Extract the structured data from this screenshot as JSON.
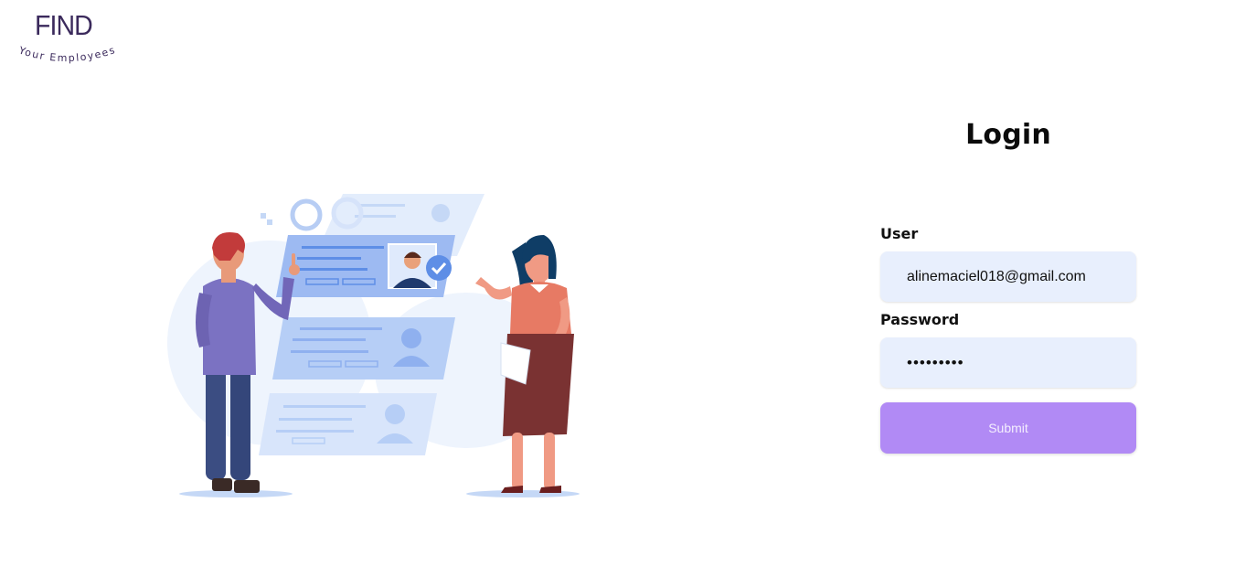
{
  "brand": {
    "name": "FIND",
    "tagline": "Your Employees"
  },
  "login": {
    "title": "Login",
    "user_label": "User",
    "user_value": "alinemaciel018@gmail.com",
    "password_label": "Password",
    "password_value": "aline1234",
    "submit_label": "Submit"
  },
  "colors": {
    "accent": "#b18af5",
    "input_bg": "#e8effd",
    "brand_text": "#3b2a5c"
  }
}
